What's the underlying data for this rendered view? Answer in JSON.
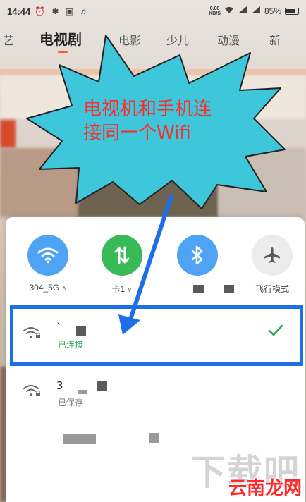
{
  "status_bar": {
    "time": "14:44",
    "status_glyphs": "⏰ ✱ ▣ ♫",
    "network_speed_value": "0.08",
    "network_speed_unit": "KB/S",
    "battery_percent": "85%"
  },
  "nav_tabs": [
    {
      "label": "艺"
    },
    {
      "label": "电视剧"
    },
    {
      "label": "电影"
    },
    {
      "label": "少儿"
    },
    {
      "label": "动漫"
    },
    {
      "label": "新"
    }
  ],
  "active_tab_index": 1,
  "colors": {
    "wifi_tile": "#4fa3f5",
    "mobile_data_tile": "#38bb57",
    "bluetooth_tile": "#4fa3f5",
    "airplane_tile": "#ececec",
    "callout_text": "#ff2b2b",
    "callout_fill": "#3ec6db",
    "highlight_border": "#1c6fe6",
    "arrow": "#1c6fe6",
    "connected_green": "#29a84c"
  },
  "quick_settings": [
    {
      "icon": "wifi-icon",
      "label": "304_5G",
      "has_chevron": true,
      "chevron": "∧"
    },
    {
      "icon": "mobile-data-icon",
      "label": "卡1",
      "has_chevron": true,
      "chevron": "∨"
    },
    {
      "icon": "bluetooth-icon",
      "label": "",
      "has_chevron": false,
      "chevron": ""
    },
    {
      "icon": "airplane-icon",
      "label": "飞行模式",
      "has_chevron": false,
      "chevron": ""
    }
  ],
  "wifi_list": [
    {
      "ssid": "`",
      "status": "已连接",
      "connected": true,
      "check": "✓"
    },
    {
      "ssid": "3",
      "status": "已保存",
      "connected": false,
      "check": ""
    }
  ],
  "callout": {
    "line1": "电视机和手机连",
    "line2": "接同一个Wifi"
  },
  "watermark": "下载吧",
  "brand": "云南龙网"
}
